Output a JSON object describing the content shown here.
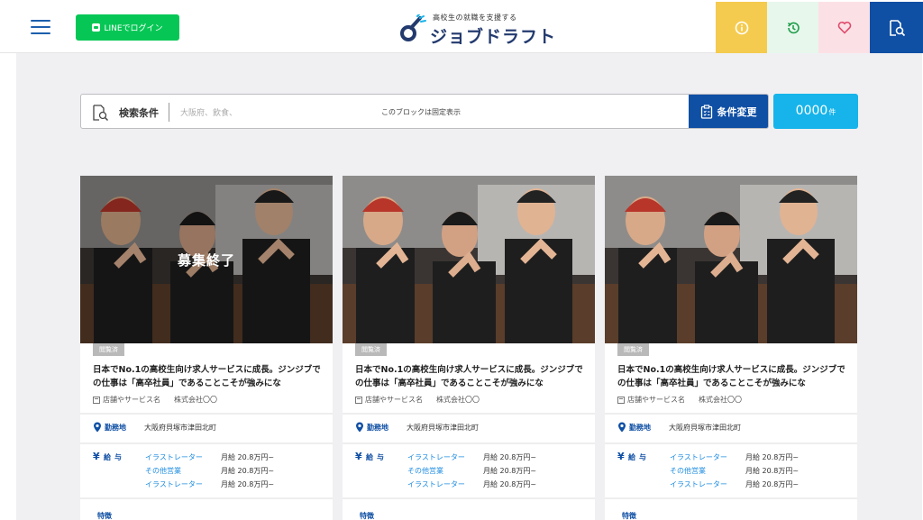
{
  "header": {
    "line_login_label": "LINEでログイン",
    "logo_tagline": "高校生の就職を支援する",
    "logo_name": "ジョブドラフト",
    "buttons": [
      {
        "name": "info",
        "icon": "info-icon",
        "color": "#f5cb4f"
      },
      {
        "name": "history",
        "icon": "history-icon",
        "color": "#e7f7ec"
      },
      {
        "name": "favorites",
        "icon": "heart-icon",
        "color": "#fbe1e6"
      },
      {
        "name": "search",
        "icon": "document-search-icon",
        "color": "#0f4fa4"
      }
    ]
  },
  "search": {
    "label": "検索条件",
    "placeholder": "大阪府、飲食、",
    "fixed_note": "このブロックは固定表示",
    "change_label": "条件変更",
    "count_value": "0000",
    "count_unit": "件"
  },
  "cards": [
    {
      "closed": true,
      "closed_label": "募集終了",
      "viewed_label": "閲覧済",
      "title": "日本でNo.1の高校生向け求人サービスに成長。ジンジブでの仕事は「高卒社員」であることこそが強みにな",
      "store_label": "店舗やサービス名",
      "company": "株式会社〇〇",
      "location_label": "勤務地",
      "location": "大阪府貝塚市津田北町",
      "salary_label": "給与",
      "salaries": [
        {
          "job": "イラストレーター",
          "amount": "月給 20.8万円~"
        },
        {
          "job": "その他営業",
          "amount": "月給 20.8万円~"
        },
        {
          "job": "イラストレーター",
          "amount": "月給 20.8万円~"
        }
      ],
      "feature_label": "特徴"
    },
    {
      "closed": false,
      "closed_label": "",
      "viewed_label": "閲覧済",
      "title": "日本でNo.1の高校生向け求人サービスに成長。ジンジブでの仕事は「高卒社員」であることこそが強みにな",
      "store_label": "店舗やサービス名",
      "company": "株式会社〇〇",
      "location_label": "勤務地",
      "location": "大阪府貝塚市津田北町",
      "salary_label": "給与",
      "salaries": [
        {
          "job": "イラストレーター",
          "amount": "月給 20.8万円~"
        },
        {
          "job": "その他営業",
          "amount": "月給 20.8万円~"
        },
        {
          "job": "イラストレーター",
          "amount": "月給 20.8万円~"
        }
      ],
      "feature_label": "特徴"
    },
    {
      "closed": false,
      "closed_label": "",
      "viewed_label": "閲覧済",
      "title": "日本でNo.1の高校生向け求人サービスに成長。ジンジブでの仕事は「高卒社員」であることこそが強みにな",
      "store_label": "店舗やサービス名",
      "company": "株式会社〇〇",
      "location_label": "勤務地",
      "location": "大阪府貝塚市津田北町",
      "salary_label": "給与",
      "salaries": [
        {
          "job": "イラストレーター",
          "amount": "月給 20.8万円~"
        },
        {
          "job": "その他営業",
          "amount": "月給 20.8万円~"
        },
        {
          "job": "イラストレーター",
          "amount": "月給 20.8万円~"
        }
      ],
      "feature_label": "特徴"
    }
  ],
  "colors": {
    "brand_blue": "#0f4fa4",
    "line_green": "#06c755",
    "count_blue": "#16b4ea",
    "link_blue": "#1d8ce0"
  }
}
